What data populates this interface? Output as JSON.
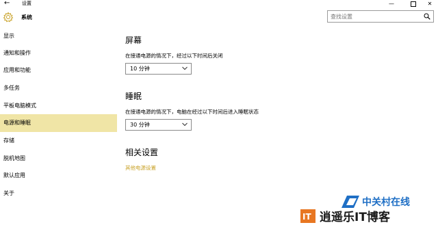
{
  "window": {
    "title": "设置",
    "back_glyph": "←",
    "minimize_glyph": "—",
    "close_glyph": "✕"
  },
  "header": {
    "title": "系统",
    "icon": "gear-icon"
  },
  "search": {
    "placeholder": "查找设置",
    "icon": "search-icon"
  },
  "sidebar": {
    "items": [
      {
        "label": "显示",
        "selected": false
      },
      {
        "label": "通知和操作",
        "selected": false
      },
      {
        "label": "应用和功能",
        "selected": false
      },
      {
        "label": "多任务",
        "selected": false
      },
      {
        "label": "平板电脑模式",
        "selected": false
      },
      {
        "label": "电源和睡眠",
        "selected": true
      },
      {
        "label": "存储",
        "selected": false
      },
      {
        "label": "脱机地图",
        "selected": false
      },
      {
        "label": "默认应用",
        "selected": false
      },
      {
        "label": "关于",
        "selected": false
      }
    ]
  },
  "screen": {
    "title": "屏幕",
    "description": "在接通电源的情况下，经过以下时间后关闭",
    "value": "10 分钟"
  },
  "sleep": {
    "title": "睡眠",
    "description": "在接通电源的情况下，电脑在经过以下时间后进入睡眠状态",
    "value": "30 分钟"
  },
  "related": {
    "title": "相关设置",
    "link": "其他电源设置"
  },
  "watermark": {
    "brand_top": "中关村在线",
    "brand_bottom": "逍遥乐IT博客",
    "logo_letter": "IT"
  },
  "colors": {
    "selected_bg": "#f0e5a6",
    "link": "#c9a227",
    "watermark_blue": "#1f6fc5",
    "watermark_orange": "#e87722"
  }
}
